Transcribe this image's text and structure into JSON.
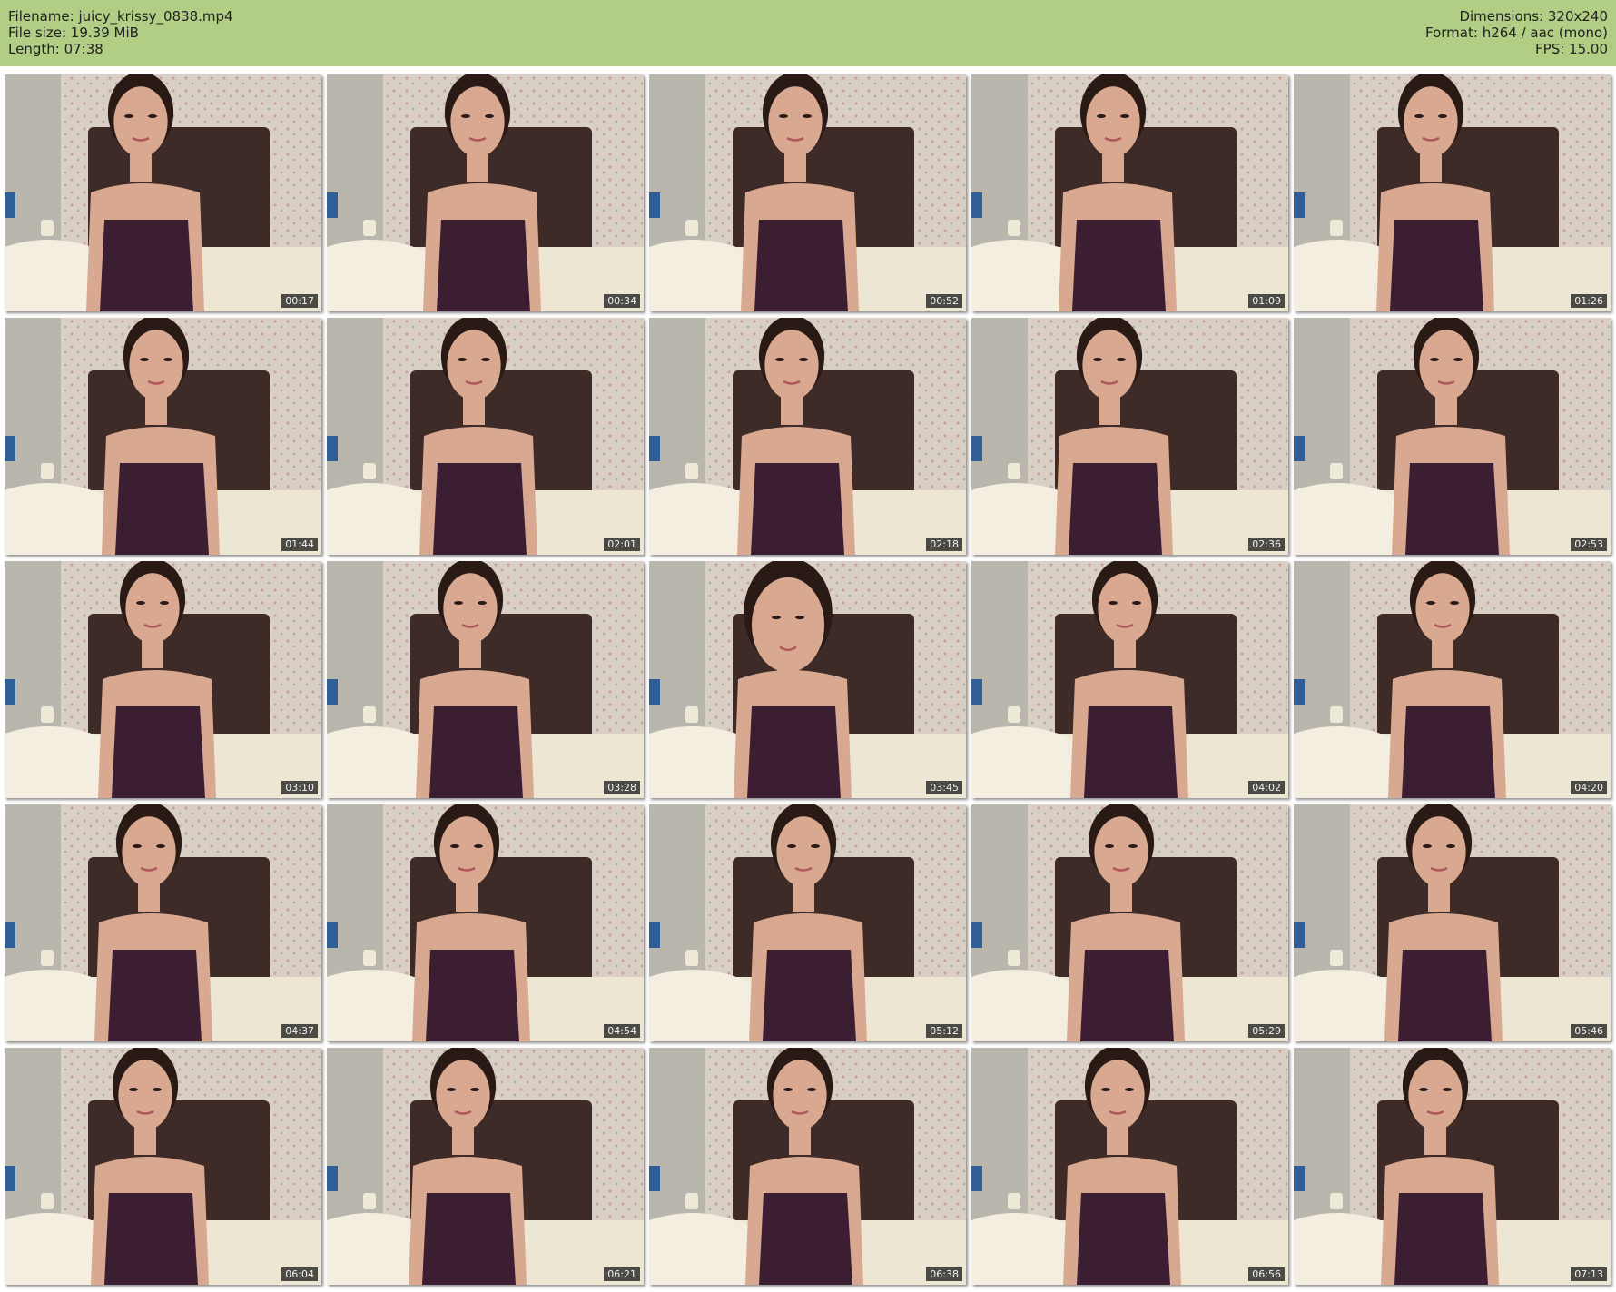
{
  "file_info": {
    "filename_label": "Filename:",
    "filename": "juicy_krissy_0838.mp4",
    "filesize_label": "File size:",
    "filesize": "19.39 MiB",
    "length_label": "Length:",
    "length": "07:38",
    "dimensions_label": "Dimensions:",
    "dimensions": "320x240",
    "format_label": "Format:",
    "format": "h264 / aac (mono)",
    "fps_label": "FPS:",
    "fps": "15.00"
  },
  "colors": {
    "header_bg": "#b2cd84",
    "wall": "#d9cfc4",
    "headboard": "#3e2a26",
    "top": "#3c1e33",
    "skin": "#d9a890",
    "hair": "#2a1a16",
    "timestamp_bg": "#1e1e1e"
  },
  "thumbnails": [
    {
      "time": "00:17"
    },
    {
      "time": "00:34"
    },
    {
      "time": "00:52"
    },
    {
      "time": "01:09"
    },
    {
      "time": "01:26"
    },
    {
      "time": "01:44"
    },
    {
      "time": "02:01"
    },
    {
      "time": "02:18"
    },
    {
      "time": "02:36"
    },
    {
      "time": "02:53"
    },
    {
      "time": "03:10"
    },
    {
      "time": "03:28"
    },
    {
      "time": "03:45"
    },
    {
      "time": "04:02"
    },
    {
      "time": "04:20"
    },
    {
      "time": "04:37"
    },
    {
      "time": "04:54"
    },
    {
      "time": "05:12"
    },
    {
      "time": "05:29"
    },
    {
      "time": "05:46"
    },
    {
      "time": "06:04"
    },
    {
      "time": "06:21"
    },
    {
      "time": "06:38"
    },
    {
      "time": "06:56"
    },
    {
      "time": "07:13"
    }
  ]
}
